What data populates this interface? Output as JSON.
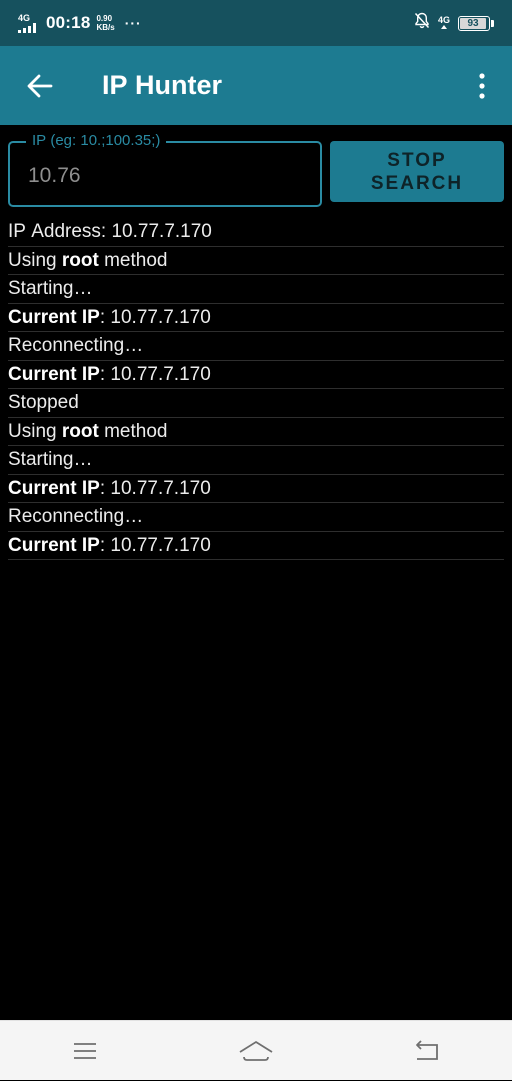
{
  "status_bar": {
    "network_label": "4G",
    "time": "00:18",
    "speed_value": "0.90",
    "speed_unit": "KB/s",
    "overflow": "···",
    "network_label_right": "4G",
    "battery": "93",
    "battery_level_pct": 93
  },
  "app_bar": {
    "back_icon": "arrow-left-icon",
    "title": "IP Hunter",
    "menu_icon": "more-vertical-icon"
  },
  "ip_field": {
    "label": "IP (eg: 10.;100.35;)",
    "value": "10.76"
  },
  "stop_button": {
    "line1": "STOP",
    "line2": "SEARCH"
  },
  "log": [
    {
      "prefix": "",
      "bold": "",
      "suffix": "IP Address: 10.77.7.170"
    },
    {
      "prefix": "Using ",
      "bold": "root",
      "suffix": " method"
    },
    {
      "prefix": "",
      "bold": "",
      "suffix": "Starting…"
    },
    {
      "prefix": "",
      "bold": "Current IP",
      "suffix": ": 10.77.7.170"
    },
    {
      "prefix": "",
      "bold": "",
      "suffix": "Reconnecting…"
    },
    {
      "prefix": "",
      "bold": "Current IP",
      "suffix": ": 10.77.7.170"
    },
    {
      "prefix": "",
      "bold": "",
      "suffix": "Stopped"
    },
    {
      "prefix": "Using ",
      "bold": "root",
      "suffix": " method"
    },
    {
      "prefix": "",
      "bold": "",
      "suffix": "Starting…"
    },
    {
      "prefix": "",
      "bold": "Current IP",
      "suffix": ": 10.77.7.170"
    },
    {
      "prefix": "",
      "bold": "",
      "suffix": "Reconnecting…"
    },
    {
      "prefix": "",
      "bold": "Current IP",
      "suffix": ": 10.77.7.170"
    }
  ],
  "nav_bar": {
    "menu_icon": "menu-lines-icon",
    "home_icon": "home-icon",
    "back_icon": "back-return-icon"
  },
  "colors": {
    "status_bar_bg": "#16515e",
    "app_bar_bg": "#1d7b91",
    "accent": "#2a8ba3",
    "background": "#000000",
    "nav_bar_bg": "#f5f5f5"
  }
}
